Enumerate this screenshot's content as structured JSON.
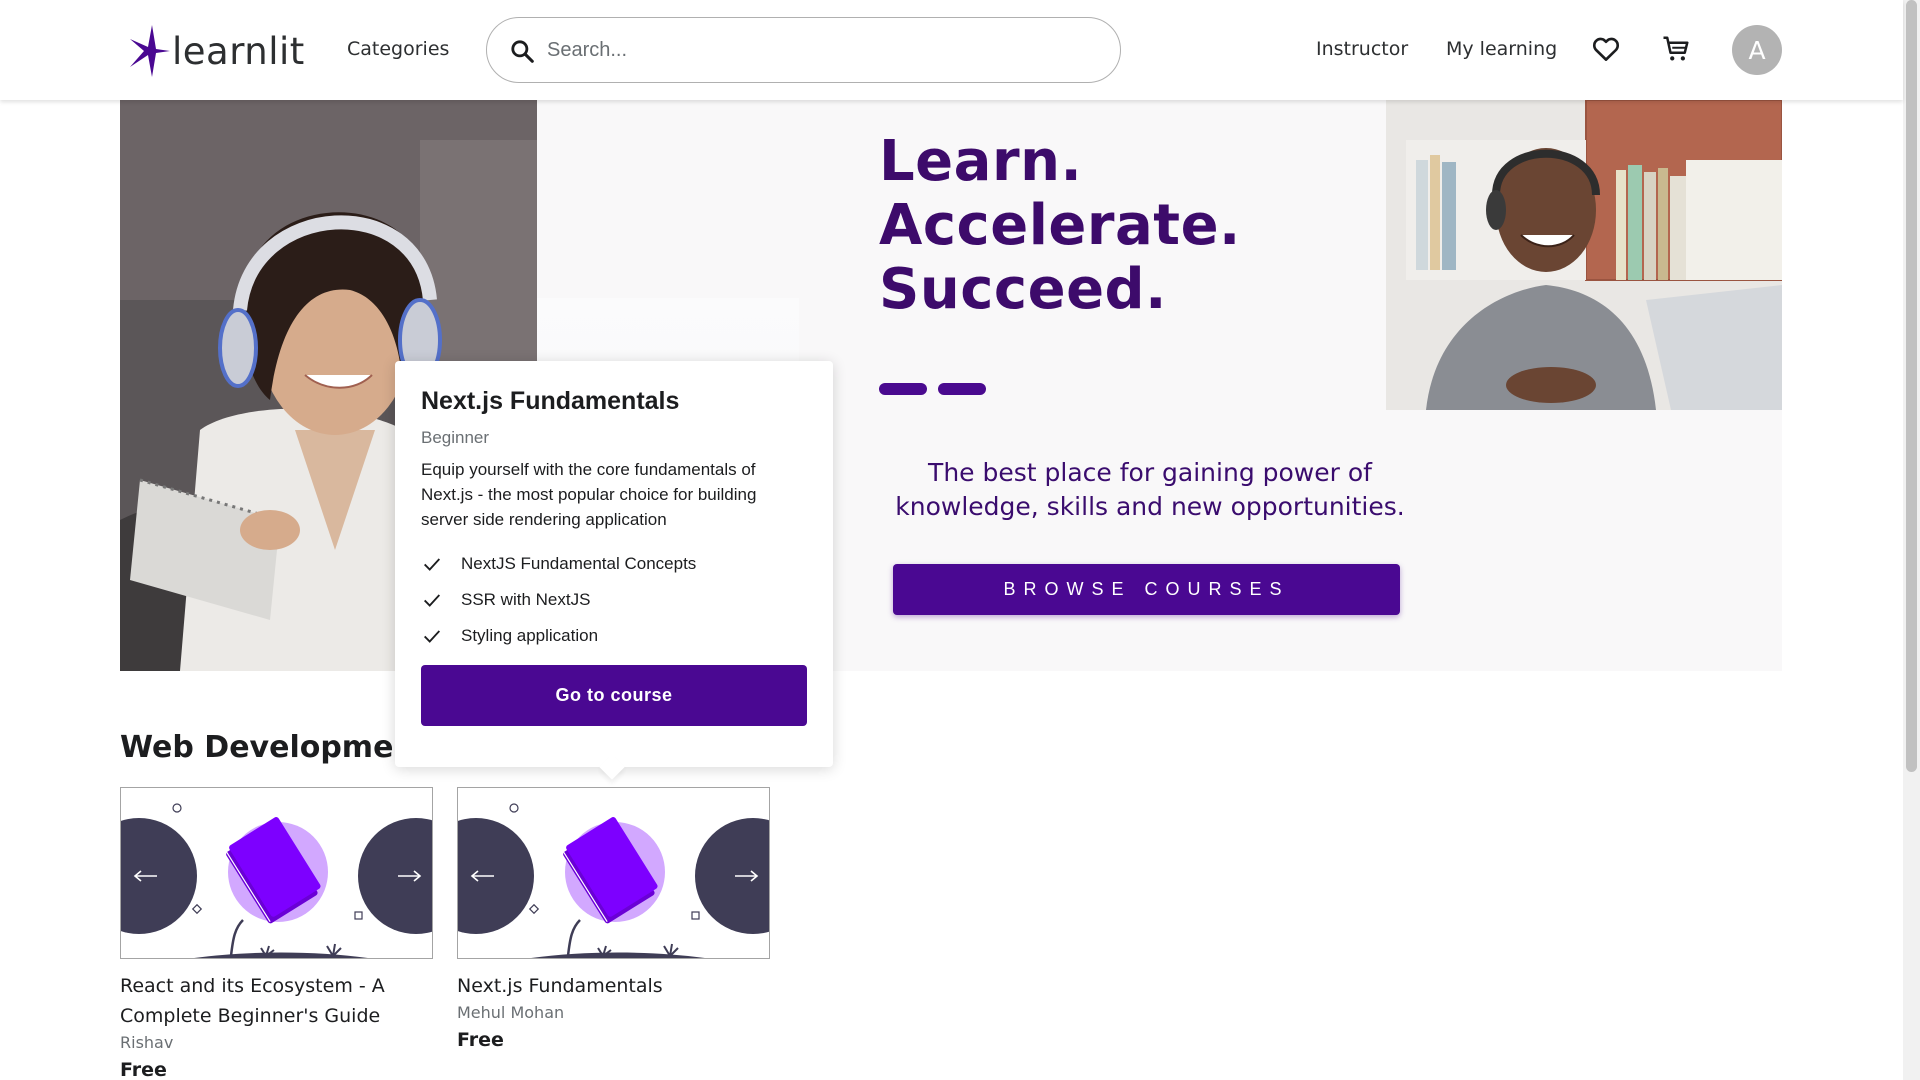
{
  "header": {
    "logo_text": "learnlit",
    "categories_label": "Categories",
    "search_placeholder": "Search...",
    "instructor_label": "Instructor",
    "my_learning_label": "My learning",
    "avatar_initial": "A"
  },
  "hero": {
    "title_lines": [
      "Learn.",
      "Accelerate.",
      "Succeed."
    ],
    "subtitle": "The best place for gaining power of knowledge, skills and new opportunities.",
    "browse_label": "BROWSE COURSES"
  },
  "section": {
    "title": "Web Development Courses"
  },
  "courses": [
    {
      "title": "React and its Ecosystem - A Complete Beginner's Guide",
      "author": "Rishav",
      "price": "Free"
    },
    {
      "title": "Next.js Fundamentals",
      "author": "Mehul Mohan",
      "price": "Free"
    }
  ],
  "popover": {
    "title": "Next.js Fundamentals",
    "level": "Beginner",
    "description": "Equip yourself with the core fundamentals of Next.js - the most popular choice for building server side rendering application",
    "features": [
      "NextJS Fundamental Concepts",
      "SSR with NextJS",
      "Styling application"
    ],
    "button_label": "Go to course"
  },
  "colors": {
    "brand_purple": "#4a0892",
    "title_purple": "#3d0b6b",
    "thumb_dark": "#3f3d56",
    "book_purple": "#7d00ff"
  },
  "icons": {
    "search": "search-icon",
    "wishlist": "heart-icon",
    "cart": "cart-icon",
    "feature_check": "check-icon"
  }
}
